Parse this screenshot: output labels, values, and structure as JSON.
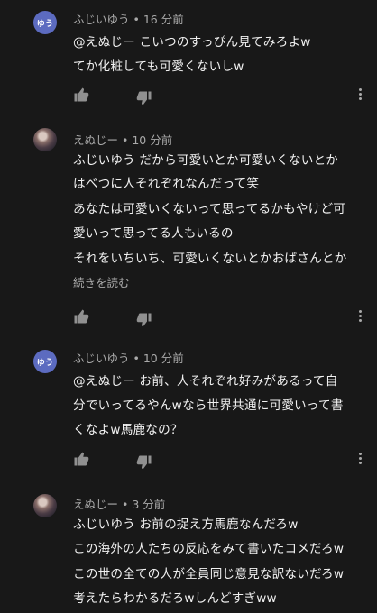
{
  "comments": [
    {
      "avatar_text": "ゆう",
      "author": "ふじいゆう",
      "time": "16 分前",
      "lines": [
        "@えぬじー こいつのすっぴん見てみろよw",
        "てか化粧しても可愛くないしw"
      ]
    },
    {
      "author": "えぬじー",
      "time": "10 分前",
      "lines": [
        "ふじいゆう だから可愛いとか可愛いくないとか",
        "はべつに人それぞれなんだって笑",
        "あなたは可愛いくないって思ってるかもやけど可",
        "愛いって思ってる人もいるの",
        "それをいちいち、可愛いくないとかおばさんとか"
      ],
      "read_more": "続きを読む"
    },
    {
      "avatar_text": "ゆう",
      "author": "ふじいゆう",
      "time": "10 分前",
      "lines": [
        "@えぬじー お前、人それぞれ好みがあるって自",
        "分でいってるやんwなら世界共通に可愛いって書",
        "くなよw馬鹿なの？"
      ]
    },
    {
      "author": "えぬじー",
      "time": "3 分前",
      "lines": [
        "ふじいゆう お前の捉え方馬鹿なんだろw",
        "この海外の人たちの反応をみて書いたコメだろw",
        "この世の全ての人が全員同じ意見な訳ないだろw",
        "考えたらわかるだろwしんどすぎww"
      ]
    }
  ],
  "separator": " • ",
  "colors": {
    "background": "#181818",
    "text": "#f1f1f1",
    "secondary": "#aaaaaa",
    "avatar_blue": "#5c6bc0"
  },
  "icons": [
    "thumb-up-icon",
    "thumb-down-icon",
    "more-vert-icon"
  ]
}
